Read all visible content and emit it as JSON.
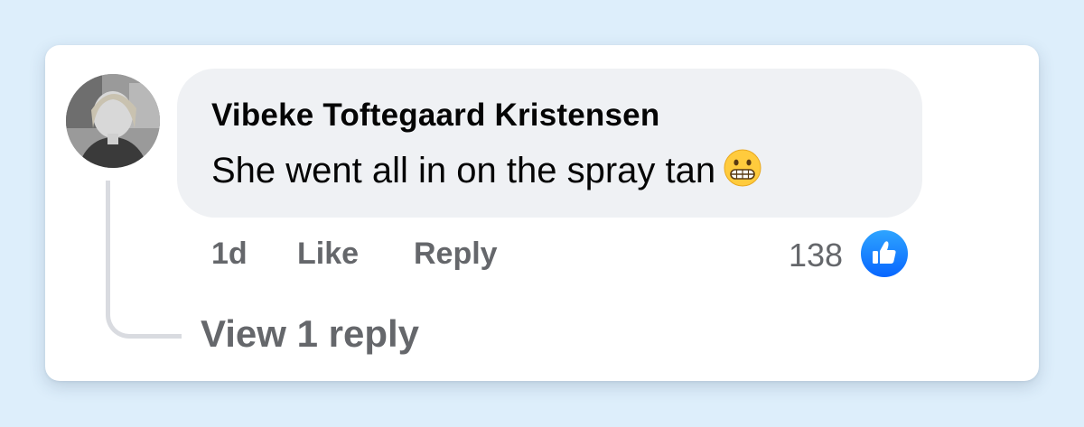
{
  "comment": {
    "author": "Vibeke Toftegaard Kristensen",
    "text": "She went all in on the spray tan",
    "emoji": "grimacing-face-emoji",
    "time": "1d",
    "like_label": "Like",
    "reply_label": "Reply",
    "reaction_count": "138",
    "reaction_icon": "thumbs-up-icon"
  },
  "replies": {
    "label": "View 1 reply"
  },
  "colors": {
    "page_background": "#ddeefb",
    "bubble_background": "#eff1f4",
    "meta_text": "#65676b",
    "like_blue": "#0866ff"
  }
}
